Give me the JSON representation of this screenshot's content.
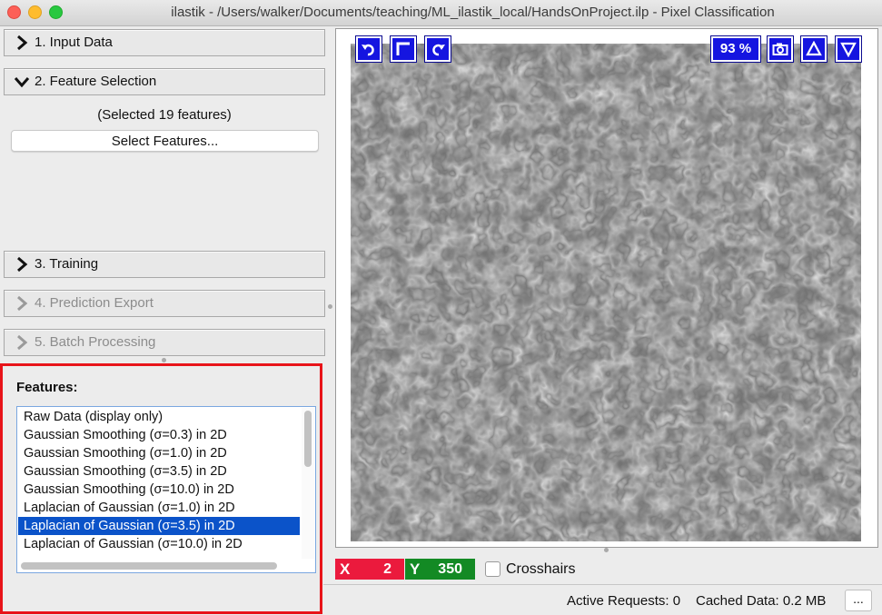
{
  "window": {
    "title": "ilastik - /Users/walker/Documents/teaching/ML_ilastik_local/HandsOnProject.ilp - Pixel Classification"
  },
  "applets": [
    {
      "label": "1. Input Data",
      "expanded": false,
      "enabled": true
    },
    {
      "label": "2. Feature Selection",
      "expanded": true,
      "enabled": true
    },
    {
      "label": "3. Training",
      "expanded": false,
      "enabled": true
    },
    {
      "label": "4. Prediction Export",
      "expanded": false,
      "enabled": false
    },
    {
      "label": "5. Batch Processing",
      "expanded": false,
      "enabled": false
    }
  ],
  "feature_selection": {
    "selected_count_text": "(Selected 19 features)",
    "select_button_label": "Select Features..."
  },
  "features": {
    "label": "Features:",
    "items": [
      "Raw Data (display only)",
      "Gaussian Smoothing (σ=0.3) in 2D",
      "Gaussian Smoothing (σ=1.0) in 2D",
      "Gaussian Smoothing (σ=3.5) in 2D",
      "Gaussian Smoothing (σ=10.0) in 2D",
      "Laplacian of Gaussian (σ=1.0) in 2D",
      "Laplacian of Gaussian (σ=3.5) in 2D",
      "Laplacian of Gaussian (σ=10.0) in 2D"
    ],
    "selected_index": 6
  },
  "viewer": {
    "zoom_label": "93 %",
    "left_controls": [
      "undo-arrow-icon",
      "fit-corner-icon",
      "redo-arrow-icon"
    ],
    "right_controls": [
      "camera-icon",
      "triangle-up-icon",
      "triangle-down-icon"
    ]
  },
  "coordinates": {
    "x_label": "X",
    "x_value": "2",
    "y_label": "Y",
    "y_value": "350",
    "x_color": "#eb1a3d",
    "y_color": "#138a24"
  },
  "crosshairs": {
    "label": "Crosshairs",
    "checked": false
  },
  "status": {
    "active_requests": "Active Requests: 0",
    "cached_data": "Cached Data: 0.2 MB",
    "more_button": "..."
  },
  "colors": {
    "highlight_border": "#e8141a",
    "selection_bg": "#0b53c9",
    "viewer_button": "#1515e0"
  }
}
